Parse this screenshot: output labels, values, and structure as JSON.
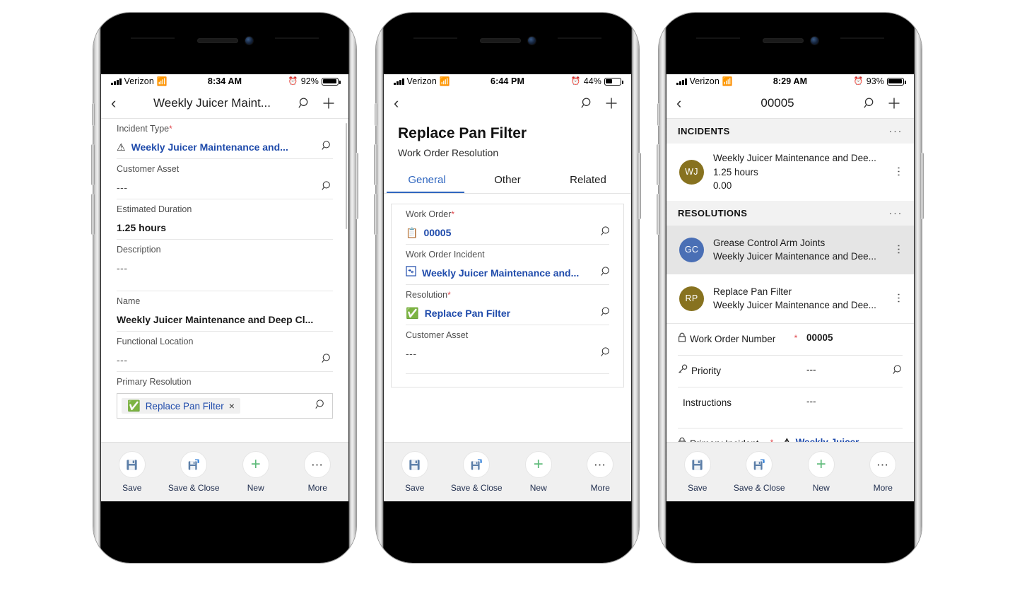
{
  "phones": [
    {
      "id": "phone-1",
      "status": {
        "carrier": "Verizon",
        "time": "8:34 AM",
        "battery_pct": "92%",
        "battery_fill": 92
      },
      "nav": {
        "title": "Weekly Juicer Maint...",
        "back": "‹",
        "search_icon": "search-icon",
        "add_icon": "plus-icon"
      },
      "fields": [
        {
          "label": "Incident Type",
          "required": true,
          "value": "Weekly Juicer Maintenance and...",
          "style": "link",
          "icon": "warning-triangle-icon",
          "lookup": true
        },
        {
          "label": "Customer Asset",
          "required": false,
          "value": "---",
          "style": "muted",
          "lookup": true
        },
        {
          "label": "Estimated Duration",
          "required": false,
          "value": "1.25 hours",
          "style": "bold",
          "lookup": false
        },
        {
          "label": "Description",
          "required": false,
          "value": "---",
          "style": "muted",
          "lookup": false
        },
        {
          "label": "Name",
          "required": false,
          "value": "Weekly Juicer Maintenance and Deep Cl...",
          "style": "bold",
          "lookup": false
        },
        {
          "label": "Functional Location",
          "required": false,
          "value": "---",
          "style": "muted",
          "lookup": true
        }
      ],
      "primary_resolution": {
        "label": "Primary Resolution",
        "pill_text": "Replace Pan Filter",
        "pill_icon": "check-circle-icon",
        "clear_icon": "×",
        "lookup": true
      }
    },
    {
      "id": "phone-2",
      "status": {
        "carrier": "Verizon",
        "time": "6:44 PM",
        "battery_pct": "44%",
        "battery_fill": 44
      },
      "nav": {
        "title": "",
        "back": "‹",
        "search_icon": "search-icon",
        "add_icon": "plus-icon"
      },
      "record": {
        "title": "Replace Pan Filter",
        "subtitle": "Work Order Resolution"
      },
      "tabs": [
        {
          "label": "General",
          "active": true
        },
        {
          "label": "Other",
          "active": false
        },
        {
          "label": "Related",
          "active": false
        }
      ],
      "fields": [
        {
          "label": "Work Order",
          "required": true,
          "value": "00005",
          "style": "link",
          "icon": "clipboard-icon",
          "lookup": true
        },
        {
          "label": "Work Order Incident",
          "required": false,
          "value": "Weekly Juicer Maintenance and...",
          "style": "link",
          "icon": "incident-icon",
          "lookup": true
        },
        {
          "label": "Resolution",
          "required": true,
          "value": "Replace Pan Filter",
          "style": "link",
          "icon": "check-circle-icon",
          "lookup": true
        },
        {
          "label": "Customer Asset",
          "required": false,
          "value": "---",
          "style": "muted",
          "lookup": true
        }
      ]
    },
    {
      "id": "phone-3",
      "status": {
        "carrier": "Verizon",
        "time": "8:29 AM",
        "battery_pct": "93%",
        "battery_fill": 93
      },
      "nav": {
        "title": "00005",
        "back": "‹",
        "search_icon": "search-icon",
        "add_icon": "plus-icon"
      },
      "sections": [
        {
          "title": "INCIDENTS",
          "overflow": "···",
          "rows": [
            {
              "initials": "WJ",
              "color": "#87721f",
              "lines": [
                "Weekly Juicer Maintenance and Dee...",
                "1.25 hours",
                "0.00"
              ],
              "selected": false
            }
          ]
        },
        {
          "title": "RESOLUTIONS",
          "overflow": "···",
          "rows": [
            {
              "initials": "GC",
              "color": "#4a6fb5",
              "lines": [
                "Grease Control Arm Joints",
                "Weekly Juicer Maintenance and Dee..."
              ],
              "selected": true
            },
            {
              "initials": "RP",
              "color": "#87721f",
              "lines": [
                "Replace Pan Filter",
                "Weekly Juicer Maintenance and Dee..."
              ],
              "selected": false
            }
          ]
        }
      ],
      "fields": [
        {
          "label": "Work Order Number",
          "icon": "lock-icon",
          "required": true,
          "value": "00005",
          "style": "bold",
          "lookup": false
        },
        {
          "label": "Priority",
          "icon": "key-icon",
          "required": false,
          "value": "---",
          "style": "muted",
          "lookup": true
        },
        {
          "label": "Instructions",
          "icon": "",
          "required": false,
          "value": "---",
          "style": "muted",
          "lookup": false
        },
        {
          "label": "Primary Incident Type",
          "icon": "lock-icon",
          "required": true,
          "value": "Weekly Juicer ...",
          "style": "link",
          "value_icon": "warning-triangle-icon",
          "lookup": false
        }
      ]
    }
  ],
  "commandbar": {
    "items": [
      {
        "label": "Save",
        "icon": "save-icon"
      },
      {
        "label": "Save & Close",
        "icon": "save-and-close-icon"
      },
      {
        "label": "New",
        "icon": "plus-icon"
      },
      {
        "label": "More",
        "icon": "more-icon"
      }
    ]
  },
  "colors": {
    "link": "#1f4bab",
    "accent_tab": "#2f66bf",
    "required": "#e0474c",
    "new_green": "#5fbb7a",
    "selected_row": "#e5e5e5",
    "section_header_bg": "#f2f2f2"
  }
}
